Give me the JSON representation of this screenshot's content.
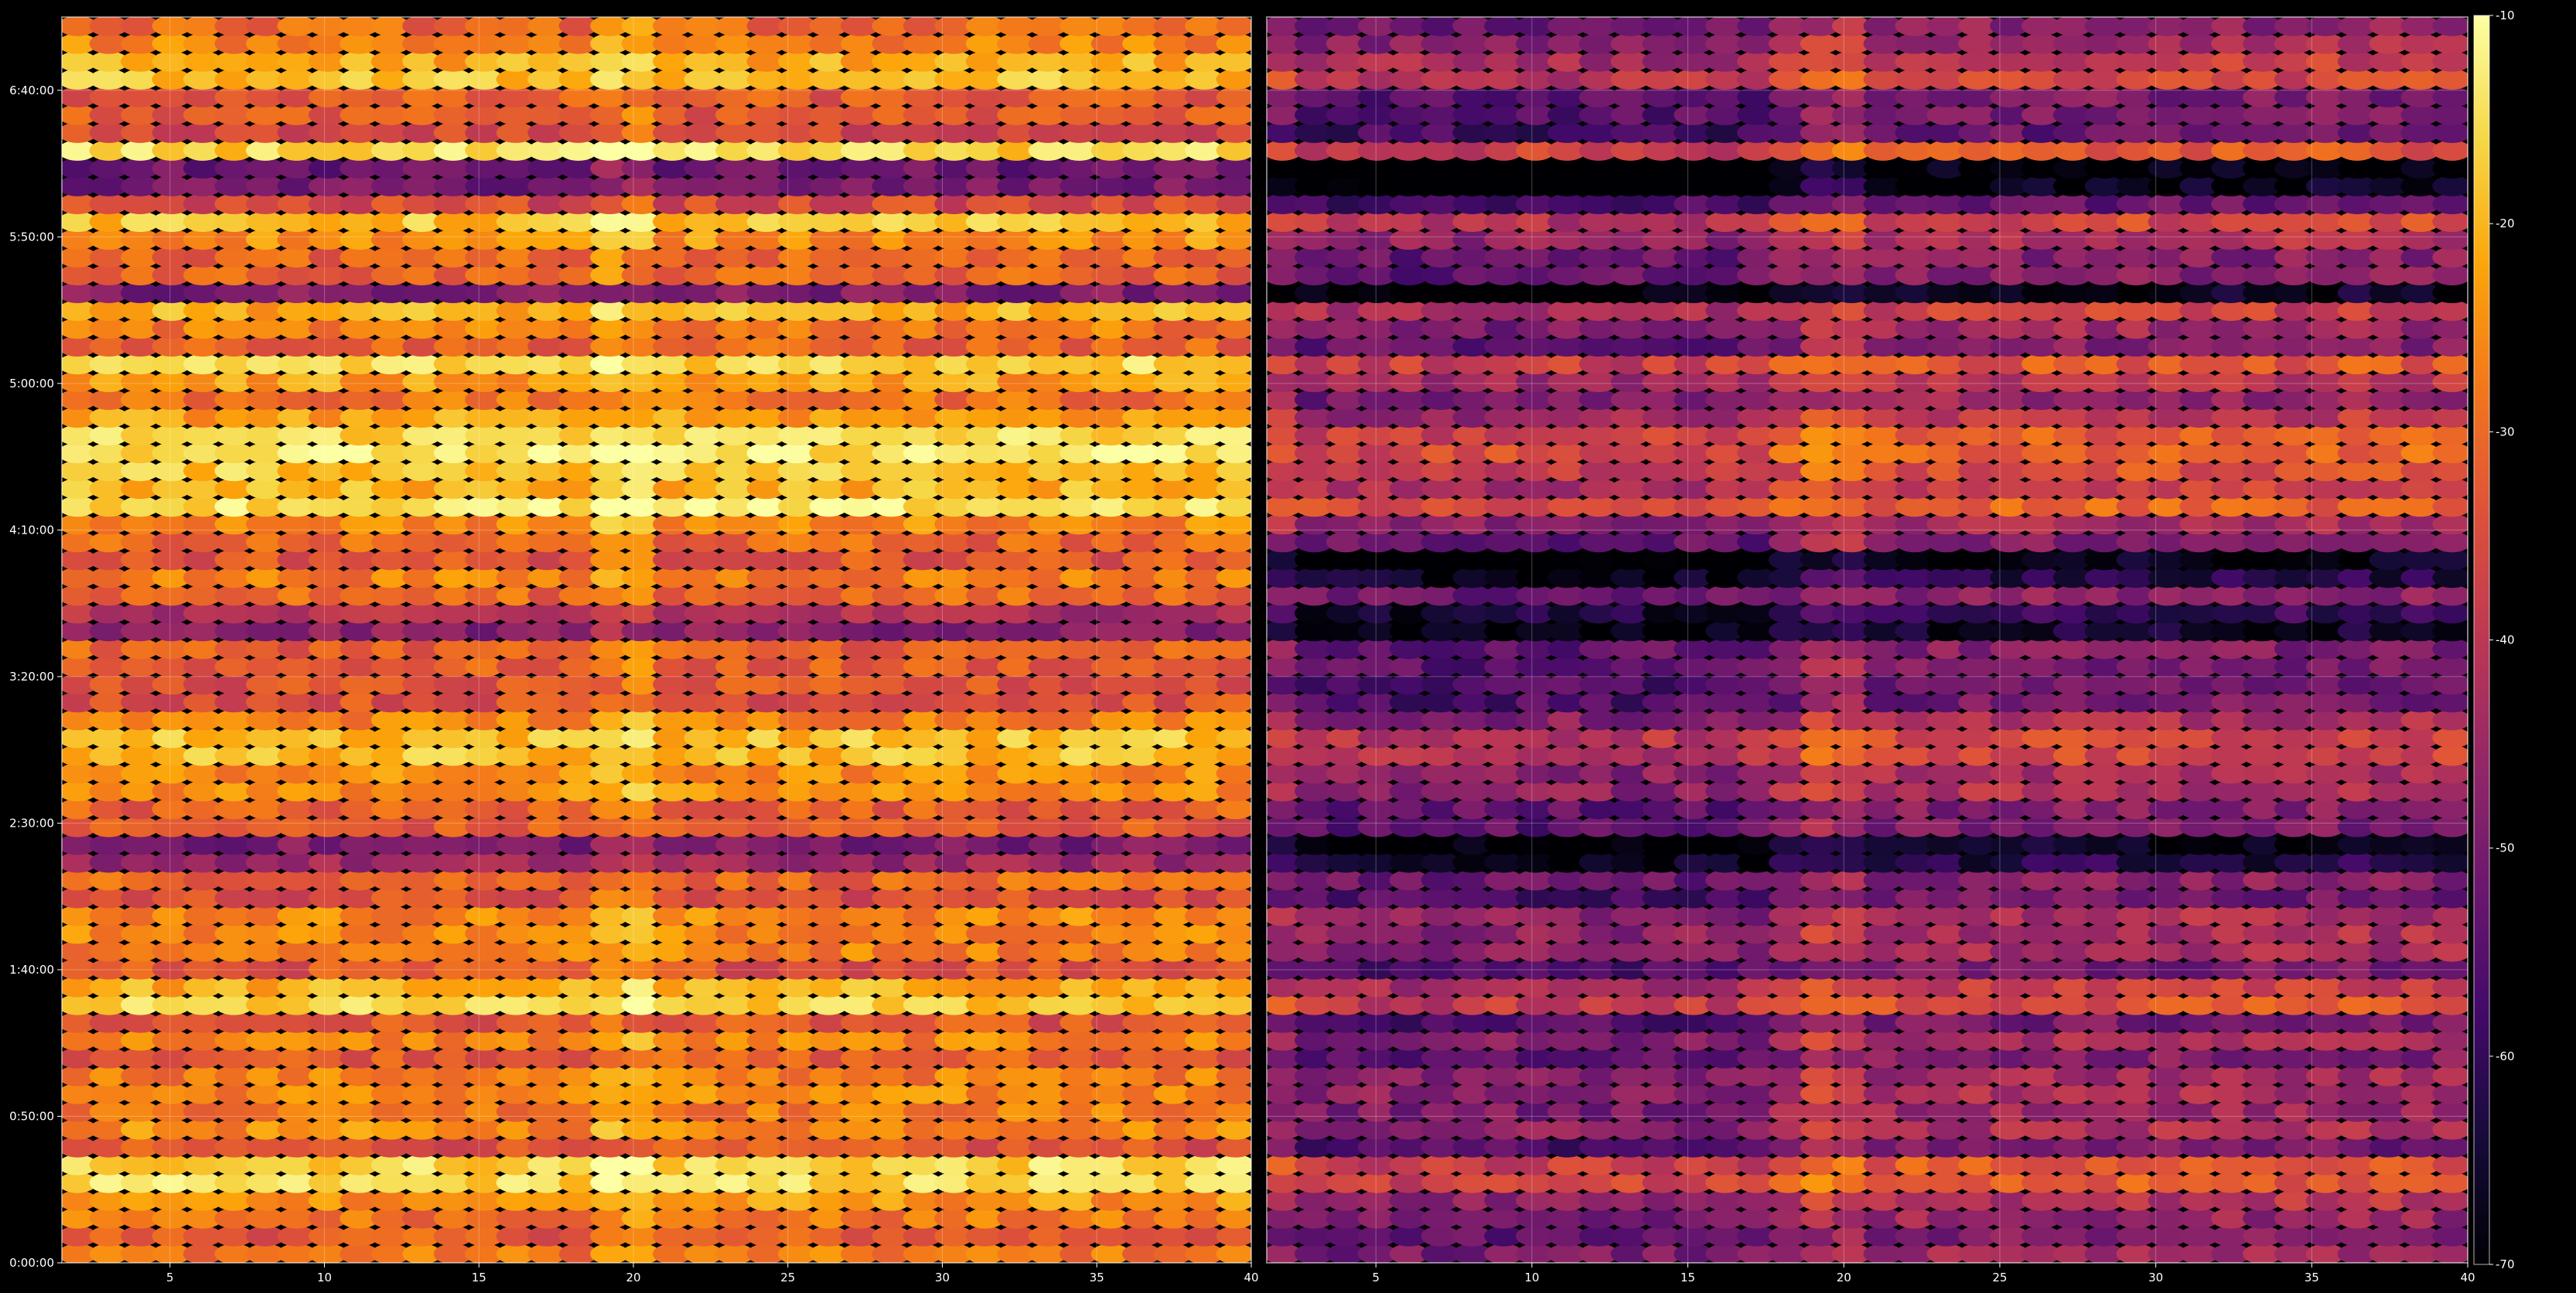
{
  "chart_data": {
    "type": "heatmap",
    "colormap": "inferno",
    "background": "#000000",
    "grid": true,
    "value_range": [
      -70,
      -10
    ],
    "colorbar": {
      "ticks": [
        "-10",
        "-20",
        "-30",
        "-40",
        "-50",
        "-60",
        "-70"
      ],
      "values": [
        -10,
        -20,
        -30,
        -40,
        -50,
        -60,
        -70
      ]
    },
    "y_ticks": [
      "0:00:00",
      "0:50:00",
      "1:40:00",
      "2:30:00",
      "3:20:00",
      "4:10:00",
      "5:00:00",
      "5:50:00",
      "6:40:00"
    ],
    "y_tick_values_minutes": [
      0,
      50,
      100,
      150,
      200,
      250,
      300,
      350,
      400
    ],
    "ylim_minutes": [
      0,
      425
    ],
    "row_count": 70,
    "column_count": 38,
    "panels": [
      {
        "name": "left",
        "xlim": [
          1.5,
          40
        ],
        "x_ticks": [
          "5",
          "10",
          "15",
          "20",
          "25",
          "30",
          "35",
          "40"
        ],
        "x_tick_values": [
          5,
          10,
          15,
          20,
          25,
          30,
          35,
          40
        ],
        "typical_level": -30,
        "strong_rows_minutes": [
          30,
          90,
          175,
          260,
          272,
          285,
          303,
          325,
          355,
          380,
          405
        ],
        "dark_rows_minutes": [
          140,
          220,
          330,
          370
        ]
      },
      {
        "name": "right",
        "xlim": [
          1.5,
          40
        ],
        "x_ticks": [
          "5",
          "10",
          "15",
          "20",
          "25",
          "30",
          "35",
          "40"
        ],
        "x_tick_values": [
          5,
          10,
          15,
          20,
          25,
          30,
          35,
          40
        ],
        "typical_level": -47,
        "strong_rows_minutes": [
          30,
          90,
          175,
          260,
          272,
          285,
          303,
          325,
          355,
          380,
          405
        ],
        "dark_rows_minutes": [
          140,
          220,
          235,
          330,
          370
        ]
      }
    ]
  }
}
